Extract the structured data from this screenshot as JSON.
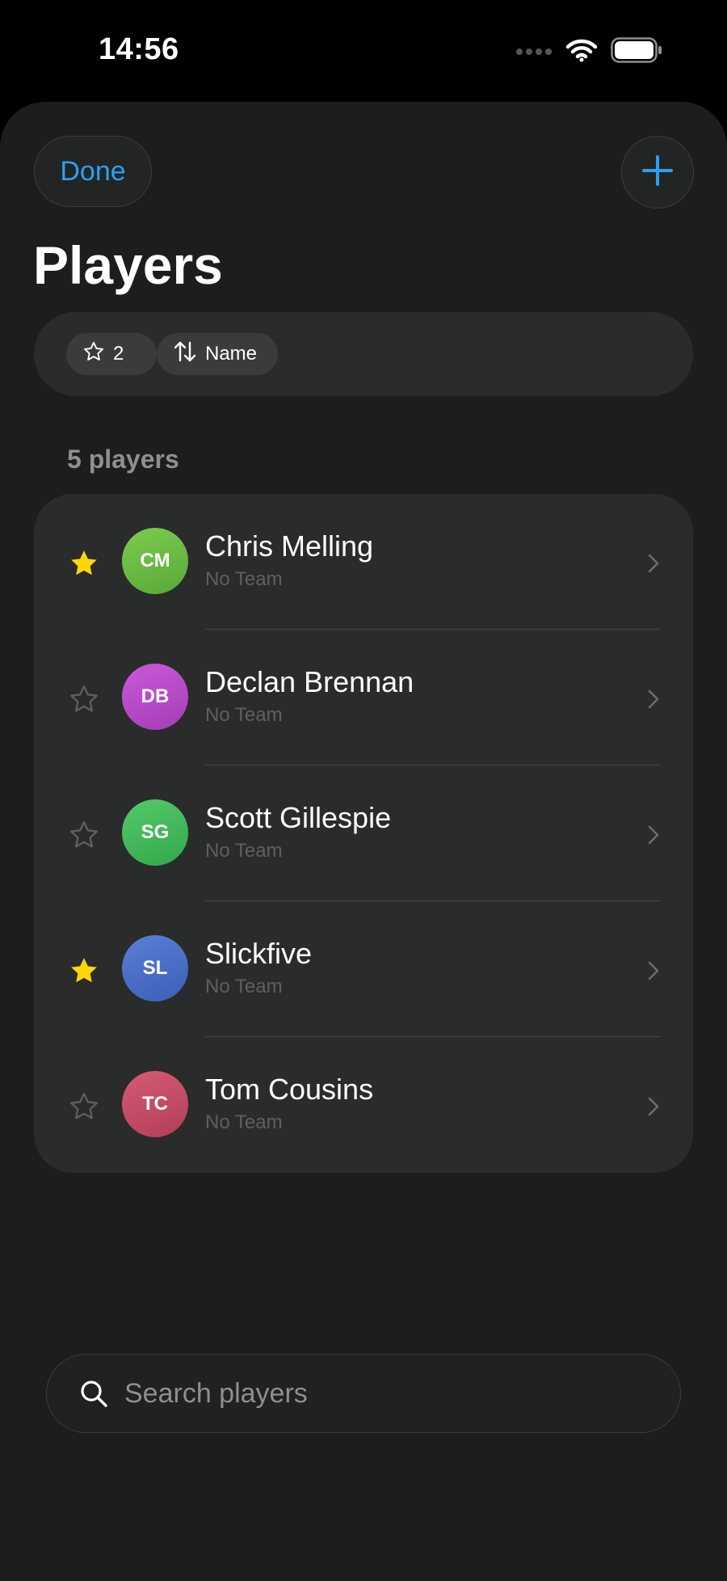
{
  "status_bar": {
    "time": "14:56"
  },
  "header": {
    "done_label": "Done",
    "title": "Players"
  },
  "filters": {
    "favorites_count": "2",
    "sort_label": "Name"
  },
  "list": {
    "count_label": "5 players",
    "players": [
      {
        "name": "Chris Melling",
        "team": "No Team",
        "initials": "CM",
        "favorite": true,
        "avatar_colors": [
          "#7ccc4e",
          "#5aa83a"
        ]
      },
      {
        "name": "Declan Brennan",
        "team": "No Team",
        "initials": "DB",
        "favorite": false,
        "avatar_colors": [
          "#c95ad8",
          "#a43db6"
        ]
      },
      {
        "name": "Scott Gillespie",
        "team": "No Team",
        "initials": "SG",
        "favorite": false,
        "avatar_colors": [
          "#55c96a",
          "#32a84b"
        ]
      },
      {
        "name": "Slickfive",
        "team": "No Team",
        "initials": "SL",
        "favorite": true,
        "avatar_colors": [
          "#5a7fd6",
          "#3c5fb8"
        ]
      },
      {
        "name": "Tom Cousins",
        "team": "No Team",
        "initials": "TC",
        "favorite": false,
        "avatar_colors": [
          "#d65a74",
          "#b23e58"
        ]
      }
    ]
  },
  "search": {
    "placeholder": "Search players"
  },
  "colors": {
    "accent": "#2aa0f5",
    "favorite_star": "#ffd60a",
    "background": "#1c1d1d",
    "card": "#2a2b2b"
  }
}
